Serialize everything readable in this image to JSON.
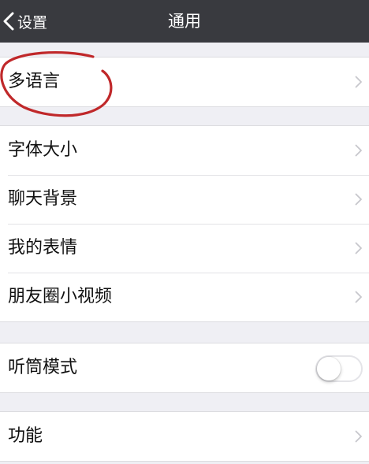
{
  "nav": {
    "back_label": "设置",
    "title": "通用"
  },
  "groups": [
    {
      "items": [
        {
          "label": "多语言",
          "control": "chevron"
        }
      ]
    },
    {
      "items": [
        {
          "label": "字体大小",
          "control": "chevron"
        },
        {
          "label": "聊天背景",
          "control": "chevron"
        },
        {
          "label": "我的表情",
          "control": "chevron"
        },
        {
          "label": "朋友圈小视频",
          "control": "chevron"
        }
      ]
    },
    {
      "items": [
        {
          "label": "听筒模式",
          "control": "toggle",
          "toggle_on": false
        }
      ]
    },
    {
      "items": [
        {
          "label": "功能",
          "control": "chevron"
        }
      ]
    }
  ],
  "annotation": {
    "shape": "hand-drawn circle",
    "color": "#c0282a"
  },
  "colors": {
    "nav_background": "#393a3f",
    "page_background": "#efeff4",
    "chevron": "#c7c7cc"
  }
}
